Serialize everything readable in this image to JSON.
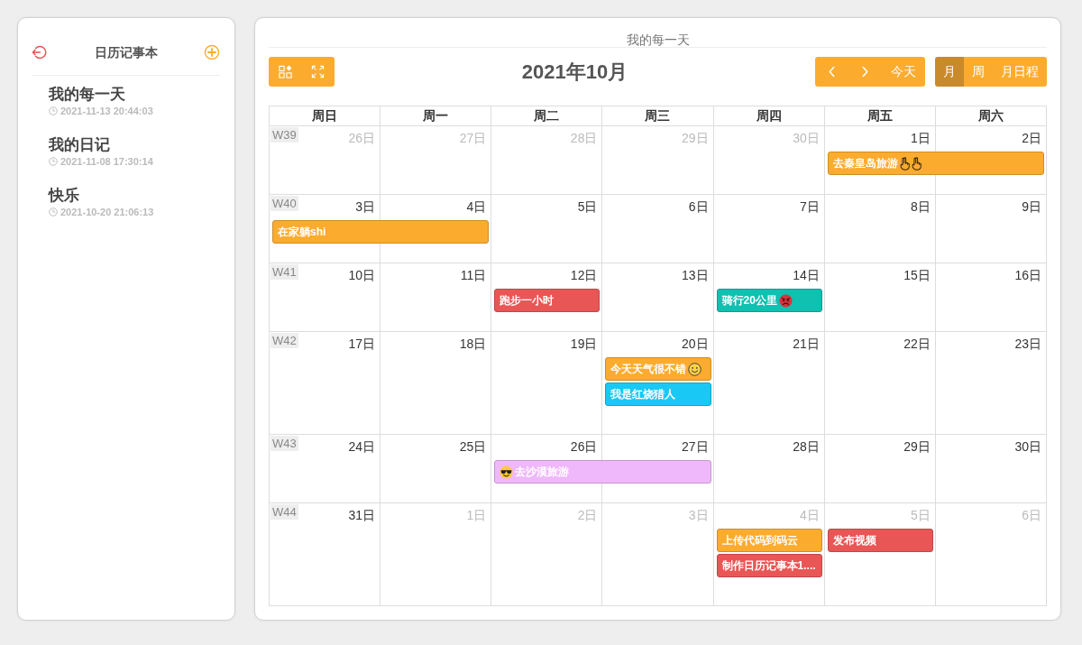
{
  "sidebar": {
    "title": "日历记事本",
    "notebooks": [
      {
        "title": "我的每一天",
        "updated": "2021-11-13 20:44:03"
      },
      {
        "title": "我的日记",
        "updated": "2021-11-08 17:30:14"
      },
      {
        "title": "快乐",
        "updated": "2021-10-20 21:06:13"
      }
    ]
  },
  "calendar": {
    "name": "我的每一天",
    "month_title": "2021年10月",
    "today_label": "今天",
    "views": [
      {
        "label": "月",
        "selected": true
      },
      {
        "label": "周",
        "selected": false
      },
      {
        "label": "月日程",
        "selected": false
      }
    ],
    "weekdays": [
      "周日",
      "周一",
      "周二",
      "周三",
      "周四",
      "周五",
      "周六"
    ],
    "weeks": [
      {
        "label": "W39",
        "days": [
          {
            "label": "26日",
            "current_month": false
          },
          {
            "label": "27日",
            "current_month": false
          },
          {
            "label": "28日",
            "current_month": false
          },
          {
            "label": "29日",
            "current_month": false
          },
          {
            "label": "30日",
            "current_month": false
          },
          {
            "label": "1日",
            "current_month": true,
            "events": [
              {
                "color": "#fbac2f",
                "through_next_day": true,
                "parts": [
                  {
                    "kind": "text",
                    "text": "去秦皇岛旅游"
                  },
                  {
                    "kind": "hand"
                  },
                  {
                    "kind": "hand"
                  }
                ]
              }
            ]
          },
          {
            "label": "2日",
            "current_month": true
          }
        ]
      },
      {
        "label": "W40",
        "days": [
          {
            "label": "3日",
            "current_month": true,
            "events": [
              {
                "color": "#fbac2f",
                "through_next_day": true,
                "parts": [
                  {
                    "kind": "text",
                    "text": "在家躺shi"
                  }
                ]
              }
            ]
          },
          {
            "label": "4日",
            "current_month": true
          },
          {
            "label": "5日",
            "current_month": true
          },
          {
            "label": "6日",
            "current_month": true
          },
          {
            "label": "7日",
            "current_month": true
          },
          {
            "label": "8日",
            "current_month": true
          },
          {
            "label": "9日",
            "current_month": true
          }
        ]
      },
      {
        "label": "W41",
        "days": [
          {
            "label": "10日",
            "current_month": true
          },
          {
            "label": "11日",
            "current_month": true
          },
          {
            "label": "12日",
            "current_month": true,
            "events": [
              {
                "color": "#e95656",
                "through_next_day": false,
                "parts": [
                  {
                    "kind": "text",
                    "text": "跑步一小时"
                  }
                ]
              }
            ]
          },
          {
            "label": "13日",
            "current_month": true
          },
          {
            "label": "14日",
            "current_month": true,
            "events": [
              {
                "color": "#10c0b0",
                "through_next_day": false,
                "parts": [
                  {
                    "kind": "text",
                    "text": "骑行20公里"
                  },
                  {
                    "kind": "angry-face"
                  }
                ]
              }
            ]
          },
          {
            "label": "15日",
            "current_month": true
          },
          {
            "label": "16日",
            "current_month": true
          }
        ]
      },
      {
        "label": "W42",
        "days": [
          {
            "label": "17日",
            "current_month": true
          },
          {
            "label": "18日",
            "current_month": true
          },
          {
            "label": "19日",
            "current_month": true
          },
          {
            "label": "20日",
            "current_month": true,
            "events": [
              {
                "color": "#fbac2f",
                "through_next_day": false,
                "parts": [
                  {
                    "kind": "text",
                    "text": "今天天气很不错"
                  },
                  {
                    "kind": "smiley"
                  }
                ]
              },
              {
                "color": "#1ac8f5",
                "through_next_day": false,
                "parts": [
                  {
                    "kind": "text",
                    "text": "我是红烧猎人"
                  }
                ]
              }
            ]
          },
          {
            "label": "21日",
            "current_month": true
          },
          {
            "label": "22日",
            "current_month": true
          },
          {
            "label": "23日",
            "current_month": true
          }
        ]
      },
      {
        "label": "W43",
        "days": [
          {
            "label": "24日",
            "current_month": true
          },
          {
            "label": "25日",
            "current_month": true
          },
          {
            "label": "26日",
            "current_month": true,
            "events": [
              {
                "color": "#efb8fb",
                "through_next_day": true,
                "parts": [
                  {
                    "kind": "sunglasses-face"
                  },
                  {
                    "kind": "text",
                    "text": "去沙漠旅游"
                  }
                ]
              }
            ]
          },
          {
            "label": "27日",
            "current_month": true
          },
          {
            "label": "28日",
            "current_month": true
          },
          {
            "label": "29日",
            "current_month": true
          },
          {
            "label": "30日",
            "current_month": true
          }
        ]
      },
      {
        "label": "W44",
        "days": [
          {
            "label": "31日",
            "current_month": true
          },
          {
            "label": "1日",
            "current_month": false
          },
          {
            "label": "2日",
            "current_month": false
          },
          {
            "label": "3日",
            "current_month": false
          },
          {
            "label": "4日",
            "current_month": false,
            "events": [
              {
                "color": "#fbac2f",
                "through_next_day": false,
                "parts": [
                  {
                    "kind": "text",
                    "text": "上传代码到码云"
                  }
                ]
              },
              {
                "color": "#e95656",
                "through_next_day": false,
                "parts": [
                  {
                    "kind": "text",
                    "text": "制作日历记事本1...."
                  }
                ]
              }
            ]
          },
          {
            "label": "5日",
            "current_month": false,
            "events": [
              {
                "color": "#e95656",
                "through_next_day": false,
                "parts": [
                  {
                    "kind": "text",
                    "text": "发布视频"
                  }
                ]
              }
            ]
          },
          {
            "label": "6日",
            "current_month": false
          }
        ]
      }
    ]
  }
}
